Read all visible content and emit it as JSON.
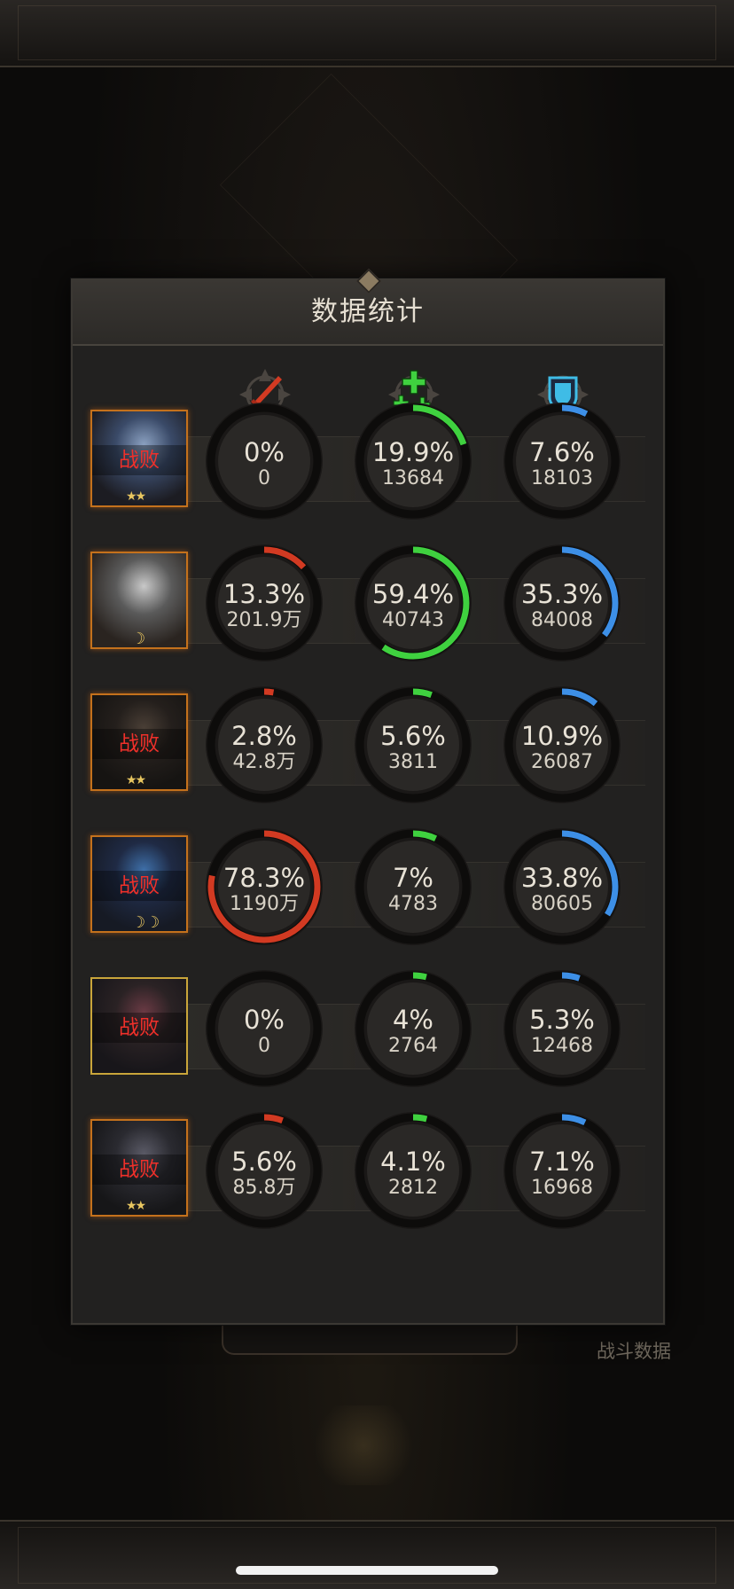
{
  "panel": {
    "title": "数据统计"
  },
  "columns": [
    {
      "icon": "sword-icon",
      "color": "#d23a22"
    },
    {
      "icon": "heal-icon",
      "color": "#3fd13f"
    },
    {
      "icon": "shield-icon",
      "color": "#3d8fe6"
    }
  ],
  "background": {
    "caption": "战斗数据"
  },
  "heroes": [
    {
      "status": "战败",
      "stars": "★★",
      "badge": "stars",
      "frame": "orange",
      "damage": {
        "pct": "0%",
        "value": "0",
        "fraction": 0.0
      },
      "heal": {
        "pct": "19.9%",
        "value": "13684",
        "fraction": 0.199
      },
      "tank": {
        "pct": "7.6%",
        "value": "18103",
        "fraction": 0.076
      }
    },
    {
      "status": "",
      "stars": "☽",
      "badge": "moon",
      "frame": "orange",
      "damage": {
        "pct": "13.3%",
        "value": "201.9万",
        "fraction": 0.133
      },
      "heal": {
        "pct": "59.4%",
        "value": "40743",
        "fraction": 0.594
      },
      "tank": {
        "pct": "35.3%",
        "value": "84008",
        "fraction": 0.353
      }
    },
    {
      "status": "战败",
      "stars": "★★",
      "badge": "stars",
      "frame": "orange",
      "damage": {
        "pct": "2.8%",
        "value": "42.8万",
        "fraction": 0.028
      },
      "heal": {
        "pct": "5.6%",
        "value": "3811",
        "fraction": 0.056
      },
      "tank": {
        "pct": "10.9%",
        "value": "26087",
        "fraction": 0.109
      }
    },
    {
      "status": "战败",
      "stars": "☽☽",
      "badge": "moon",
      "frame": "orange",
      "damage": {
        "pct": "78.3%",
        "value": "1190万",
        "fraction": 0.783
      },
      "heal": {
        "pct": "7%",
        "value": "4783",
        "fraction": 0.07
      },
      "tank": {
        "pct": "33.8%",
        "value": "80605",
        "fraction": 0.338
      }
    },
    {
      "status": "战败",
      "stars": "",
      "badge": "none",
      "frame": "gold",
      "damage": {
        "pct": "0%",
        "value": "0",
        "fraction": 0.0
      },
      "heal": {
        "pct": "4%",
        "value": "2764",
        "fraction": 0.04
      },
      "tank": {
        "pct": "5.3%",
        "value": "12468",
        "fraction": 0.053
      }
    },
    {
      "status": "战败",
      "stars": "★★",
      "badge": "stars",
      "frame": "orange",
      "damage": {
        "pct": "5.6%",
        "value": "85.8万",
        "fraction": 0.056
      },
      "heal": {
        "pct": "4.1%",
        "value": "2812",
        "fraction": 0.041
      },
      "tank": {
        "pct": "7.1%",
        "value": "16968",
        "fraction": 0.071
      }
    }
  ]
}
